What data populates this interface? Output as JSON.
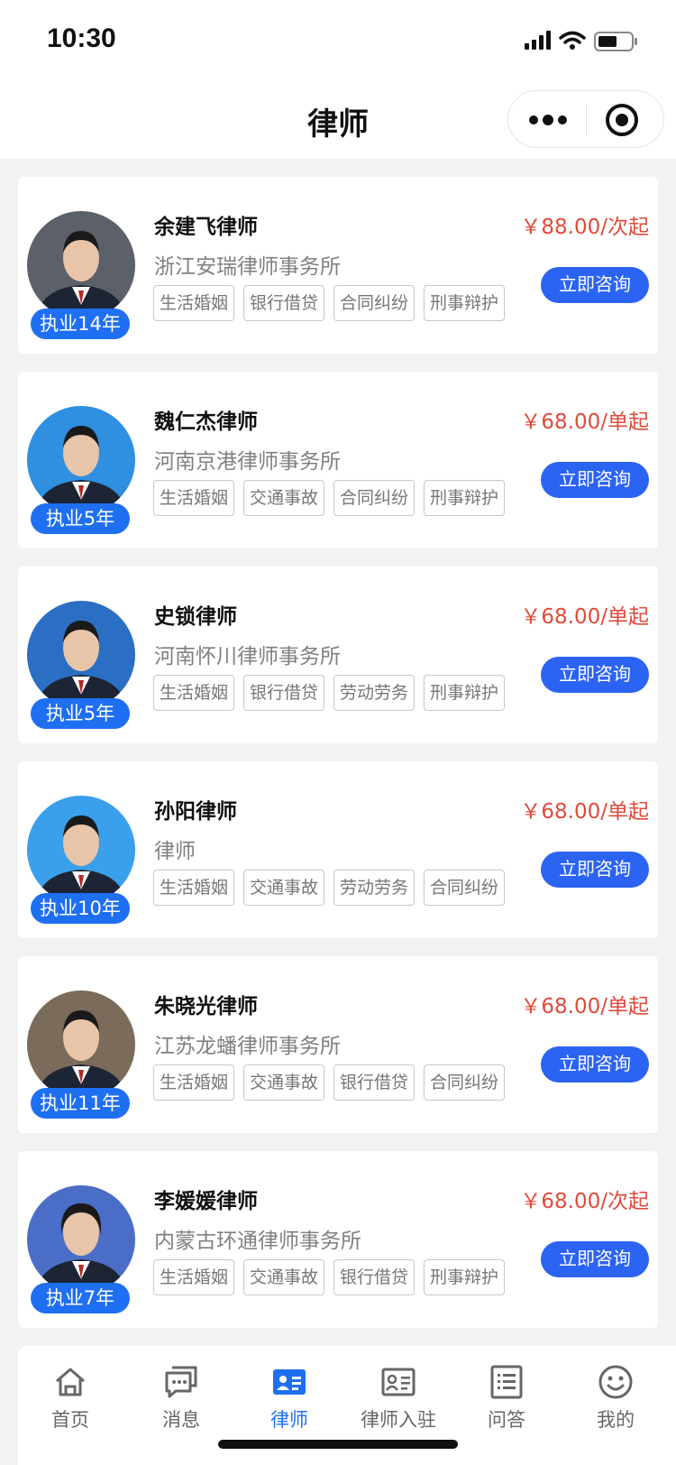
{
  "status_bar": {
    "time": "10:30"
  },
  "nav": {
    "title": "律师"
  },
  "lawyers": [
    {
      "name": "余建飞律师",
      "firm": "浙江安瑞律师事务所",
      "years": "执业14年",
      "price": "￥88.00/次起",
      "tags": [
        "生活婚姻",
        "银行借贷",
        "合同纠纷",
        "刑事辩护"
      ],
      "consult": "立即咨询"
    },
    {
      "name": "魏仁杰律师",
      "firm": "河南京港律师事务所",
      "years": "执业5年",
      "price": "￥68.00/单起",
      "tags": [
        "生活婚姻",
        "交通事故",
        "合同纠纷",
        "刑事辩护"
      ],
      "consult": "立即咨询"
    },
    {
      "name": "史锁律师",
      "firm": "河南怀川律师事务所",
      "years": "执业5年",
      "price": "￥68.00/单起",
      "tags": [
        "生活婚姻",
        "银行借贷",
        "劳动劳务",
        "刑事辩护"
      ],
      "consult": "立即咨询"
    },
    {
      "name": "孙阳律师",
      "firm": "律师",
      "years": "执业10年",
      "price": "￥68.00/单起",
      "tags": [
        "生活婚姻",
        "交通事故",
        "劳动劳务",
        "合同纠纷"
      ],
      "consult": "立即咨询"
    },
    {
      "name": "朱晓光律师",
      "firm": "江苏龙蟠律师事务所",
      "years": "执业11年",
      "price": "￥68.00/单起",
      "tags": [
        "生活婚姻",
        "交通事故",
        "银行借贷",
        "合同纠纷"
      ],
      "consult": "立即咨询"
    },
    {
      "name": "李媛媛律师",
      "firm": "内蒙古环通律师事务所",
      "years": "执业7年",
      "price": "￥68.00/次起",
      "tags": [
        "生活婚姻",
        "交通事故",
        "银行借贷",
        "刑事辩护"
      ],
      "consult": "立即咨询"
    }
  ],
  "tab_bar": [
    {
      "label": "首页",
      "icon": "home-icon"
    },
    {
      "label": "消息",
      "icon": "message-icon"
    },
    {
      "label": "律师",
      "icon": "lawyer-card-icon",
      "active": true
    },
    {
      "label": "律师入驻",
      "icon": "id-card-icon"
    },
    {
      "label": "问答",
      "icon": "list-icon"
    },
    {
      "label": "我的",
      "icon": "smile-icon"
    }
  ],
  "colors": {
    "accent": "#1e6ff2",
    "button": "#2b63f3",
    "price": "#e04a3a",
    "background": "#f2f2f2"
  }
}
